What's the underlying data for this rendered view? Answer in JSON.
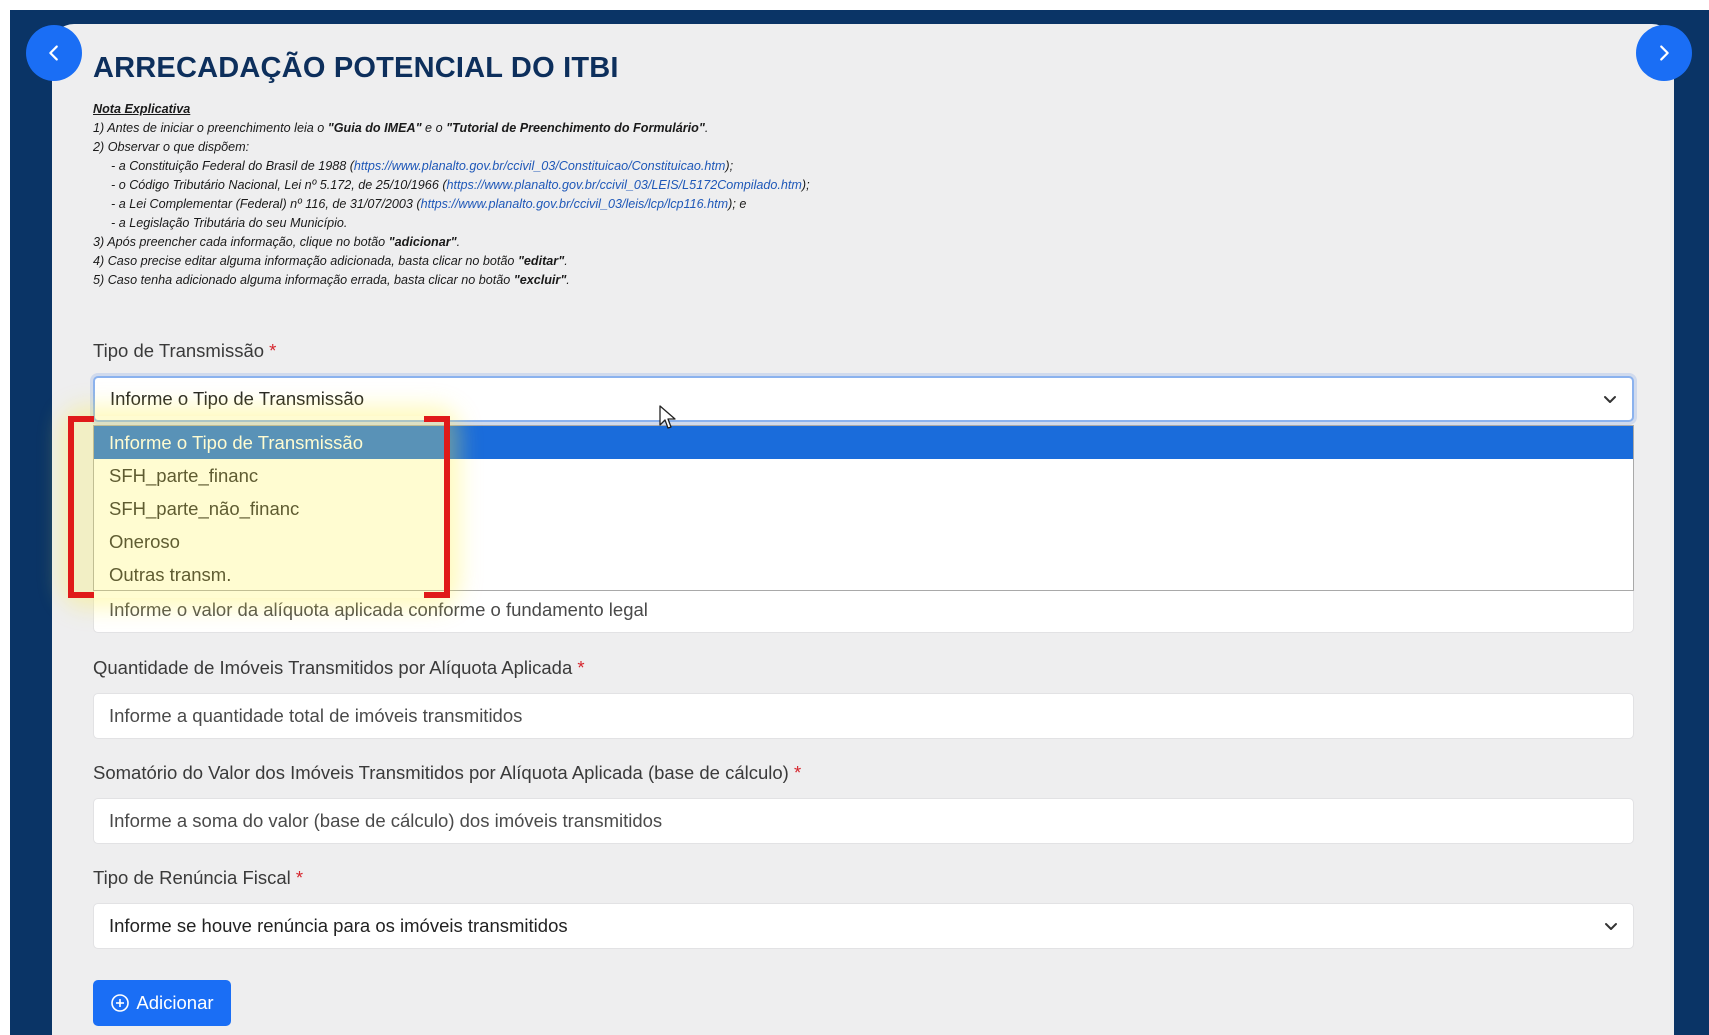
{
  "page": {
    "title": "ARRECADAÇÃO POTENCIAL DO ITBI",
    "prev_icon": "chevron-left-icon",
    "next_icon": "chevron-right-icon"
  },
  "notes": {
    "heading": "Nota Explicativa",
    "line1_a": "1) Antes de iniciar o preenchimento leia o ",
    "line1_b": "\"Guia do IMEA\"",
    "line1_c": " e o ",
    "line1_d": "\"Tutorial de Preenchimento do Formulário\"",
    "line1_e": ".",
    "line2": "2) Observar o que dispõem:",
    "line3_a": "- a Constituição Federal do Brasil de 1988 (",
    "line3_link": "https://www.planalto.gov.br/ccivil_03/Constituicao/Constituicao.htm",
    "line3_b": ");",
    "line4_a": "- o Código Tributário Nacional, Lei nº 5.172, de 25/10/1966 (",
    "line4_link": "https://www.planalto.gov.br/ccivil_03/LEIS/L5172Compilado.htm",
    "line4_b": ");",
    "line5_a": "- a Lei Complementar (Federal) nº 116, de 31/07/2003 (",
    "line5_link": "https://www.planalto.gov.br/ccivil_03/leis/lcp/lcp116.htm",
    "line5_b": "); e",
    "line6": "- a Legislação Tributária do seu Município.",
    "line7_a": "3) Após preencher cada informação, clique no botão ",
    "line7_b": "\"adicionar\"",
    "line7_c": ".",
    "line8_a": "4) Caso precise editar alguma informação adicionada, basta clicar no botão ",
    "line8_b": "\"editar\"",
    "line8_c": ".",
    "line9_a": "5) Caso tenha adicionado alguma informação errada, basta clicar no botão ",
    "line9_b": "\"excluir\"",
    "line9_c": "."
  },
  "form": {
    "required_mark": "*",
    "tipo_transmissao": {
      "label": "Tipo de Transmissão",
      "value": "Informe o Tipo de Transmissão",
      "options": [
        "Informe o Tipo de Transmissão",
        "SFH_parte_financ",
        "SFH_parte_não_financ",
        "Oneroso",
        "Outras transm."
      ],
      "selected_index": 0
    },
    "aliquota": {
      "placeholder": "Informe o valor da alíquota aplicada conforme o fundamento legal"
    },
    "quantidade": {
      "label": "Quantidade de Imóveis Transmitidos por Alíquota Aplicada",
      "placeholder": "Informe a quantidade total de imóveis transmitidos"
    },
    "somatorio": {
      "label": "Somatório do Valor dos Imóveis Transmitidos por Alíquota Aplicada (base de cálculo)",
      "placeholder": "Informe a soma do valor (base de cálculo) dos imóveis transmitidos"
    },
    "renuncia": {
      "label": "Tipo de Renúncia Fiscal",
      "value": "Informe se houve renúncia para os imóveis transmitidos"
    },
    "add_button": "Adicionar"
  },
  "colors": {
    "frame": "#0a3466",
    "accent": "#1a6ef5",
    "title": "#0d2f5c",
    "required": "#d6262e",
    "annotation": "#e01a1a"
  }
}
